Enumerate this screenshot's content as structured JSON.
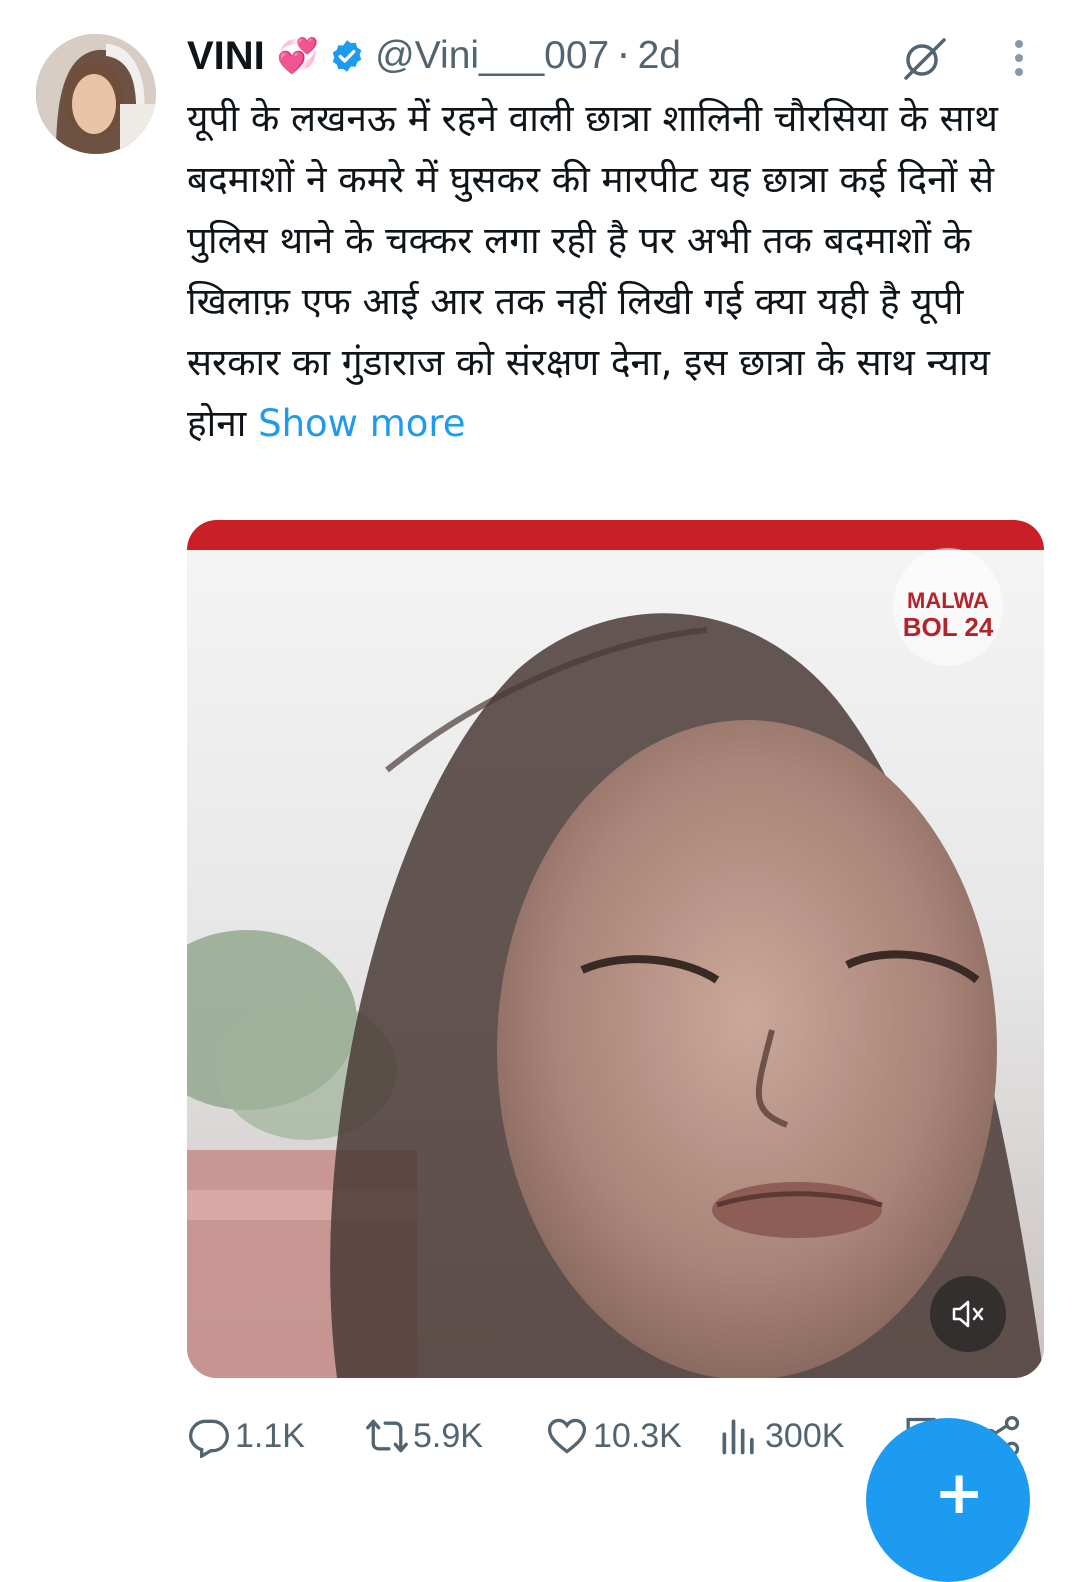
{
  "tweet": {
    "author_name": "VINI",
    "author_emoji": "💞",
    "handle": "@Vini___007",
    "separator": "·",
    "time": "2d",
    "text": "यूपी के लखनऊ में रहने वाली छात्रा शालिनी चौरसिया के साथ बदमाशों ने कमरे में घुसकर की मारपीट यह छात्रा कई दिनों से पुलिस थाने के चक्कर लगा रही है पर अभी तक बदमाशों के खिलाफ़ एफ आई आर तक नहीं लिखी गई क्या यही है यूपी सरकार का गुंडाराज को संरक्षण देना, इस छात्रा के साथ न्याय होना ",
    "show_more": "Show more"
  },
  "media": {
    "watermark_line1": "MALWA",
    "watermark_line2": "BOL 24",
    "mute_icon": "volume-muted-icon"
  },
  "actions": {
    "replies": "1.1K",
    "reposts": "5.9K",
    "likes": "10.3K",
    "views": "300K"
  },
  "colors": {
    "accent": "#1d9bf0",
    "text": "#0f1419",
    "secondary": "#536471",
    "heart_emoji": "#e64d9b",
    "banner_red": "#c82026"
  }
}
